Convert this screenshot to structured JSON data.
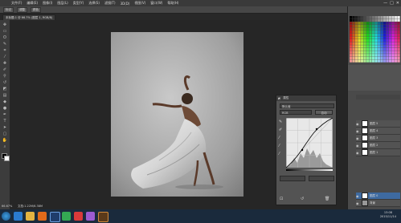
{
  "menubar": {
    "items": [
      "文件(F)",
      "编辑(E)",
      "图像(I)",
      "图层(L)",
      "类型(Y)",
      "选择(S)",
      "滤镜(T)",
      "3D(D)",
      "视图(V)",
      "窗口(W)",
      "帮助(H)"
    ],
    "window_buttons": [
      "—",
      "□",
      "✕"
    ]
  },
  "options": {
    "chips": [
      "标记",
      "调整",
      "颜色"
    ]
  },
  "document": {
    "tab_label": "未标题-1 @ 66.7% (图层 1, RGB/8)"
  },
  "tools": [
    "move-icon",
    "marquee-icon",
    "lasso-icon",
    "quick-select-icon",
    "crop-icon",
    "eyedropper-icon",
    "healing-icon",
    "brush-icon",
    "stamp-icon",
    "history-brush-icon",
    "eraser-icon",
    "gradient-icon",
    "blur-icon",
    "dodge-icon",
    "pen-icon",
    "type-icon",
    "path-select-icon",
    "shape-icon",
    "hand-icon",
    "zoom-icon"
  ],
  "curves": {
    "title": "属性",
    "preset": "默认值",
    "channel": "RGB",
    "auto": "自动"
  },
  "layers": {
    "rows": [
      "图层 5",
      "图层 4",
      "图层 3",
      "图层 2",
      "图层 1",
      "图层 0",
      "背景"
    ]
  },
  "status": {
    "zoom": "66.67%",
    "doc": "文档:1.22M/6.38M"
  },
  "clock": {
    "time": "13:08",
    "date": "2015/11/14"
  },
  "taskbar": {
    "icons": [
      "start-icon",
      "ie-icon",
      "explorer-icon",
      "media-icon",
      "photoshop-icon",
      "app-icon",
      "app-icon-2",
      "app-icon-3",
      "bridge-icon"
    ]
  }
}
